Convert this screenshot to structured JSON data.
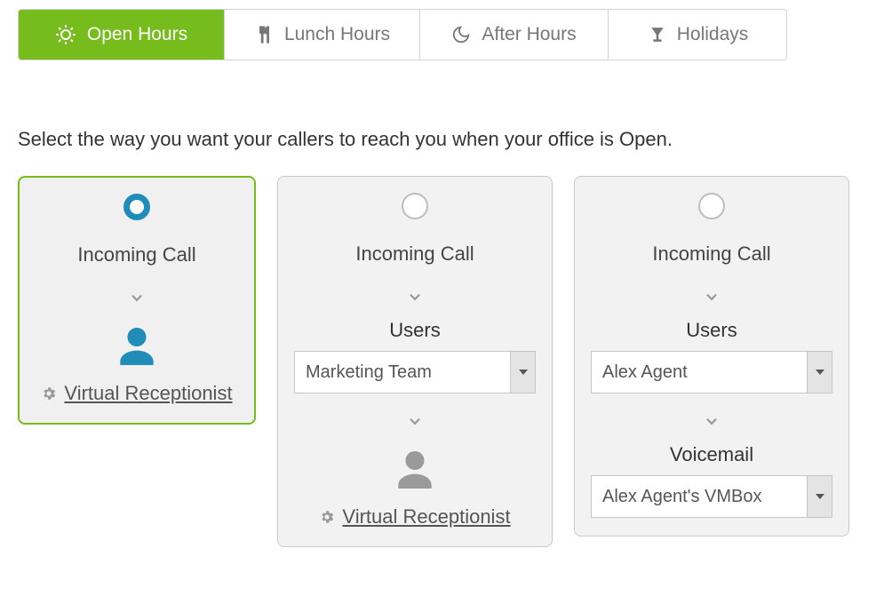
{
  "tabs": [
    {
      "label": "Open Hours",
      "active": true
    },
    {
      "label": "Lunch Hours",
      "active": false
    },
    {
      "label": "After Hours",
      "active": false
    },
    {
      "label": "Holidays",
      "active": false
    }
  ],
  "instruction": "Select the way you want your callers to reach you when your office is Open.",
  "cards": {
    "card1": {
      "title": "Incoming Call",
      "vr_link": "Virtual Receptionist"
    },
    "card2": {
      "title": "Incoming Call",
      "users_label": "Users",
      "users_value": "Marketing Team",
      "vr_link": "Virtual Receptionist"
    },
    "card3": {
      "title": "Incoming Call",
      "users_label": "Users",
      "users_value": "Alex Agent",
      "voicemail_label": "Voicemail",
      "voicemail_value": "Alex Agent's VMBox"
    }
  },
  "colors": {
    "accent_green": "#76bc1c",
    "accent_blue": "#1f8db8",
    "text_gray": "#777777",
    "icon_gray": "#9a9a9a"
  }
}
